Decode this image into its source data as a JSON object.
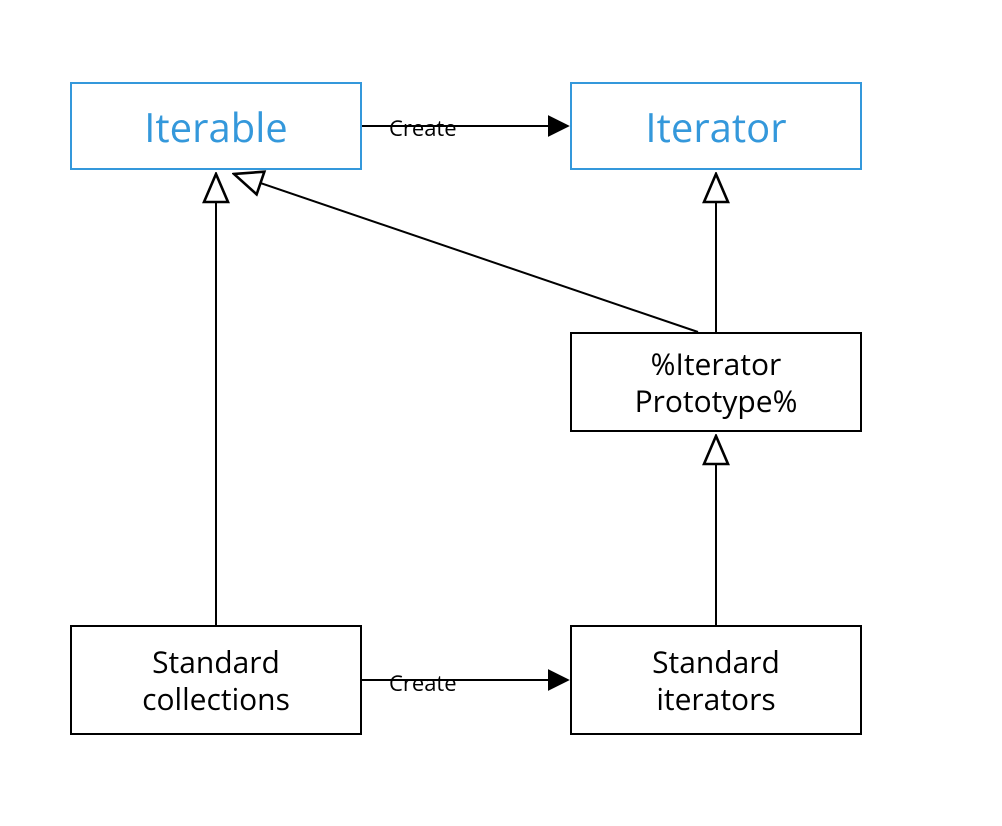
{
  "nodes": {
    "iterable": {
      "label": "Iterable"
    },
    "iterator": {
      "label": "Iterator"
    },
    "iteratorPrototype": {
      "label": "%Iterator\nPrototype%"
    },
    "standardCollections": {
      "label": "Standard\ncollections"
    },
    "standardIterators": {
      "label": "Standard\niterators"
    }
  },
  "edges": {
    "iterableToIterator": {
      "label": "Create",
      "type": "solid-arrow"
    },
    "collectionsToIterators": {
      "label": "Create",
      "type": "solid-arrow"
    },
    "collectionsToIterable": {
      "type": "hollow-arrow"
    },
    "prototypeToIterator": {
      "type": "hollow-arrow"
    },
    "prototypeToIterable": {
      "type": "hollow-arrow"
    },
    "iteratorsToPrototype": {
      "type": "hollow-arrow"
    }
  },
  "colors": {
    "blue": "#3498db",
    "black": "#000000"
  }
}
